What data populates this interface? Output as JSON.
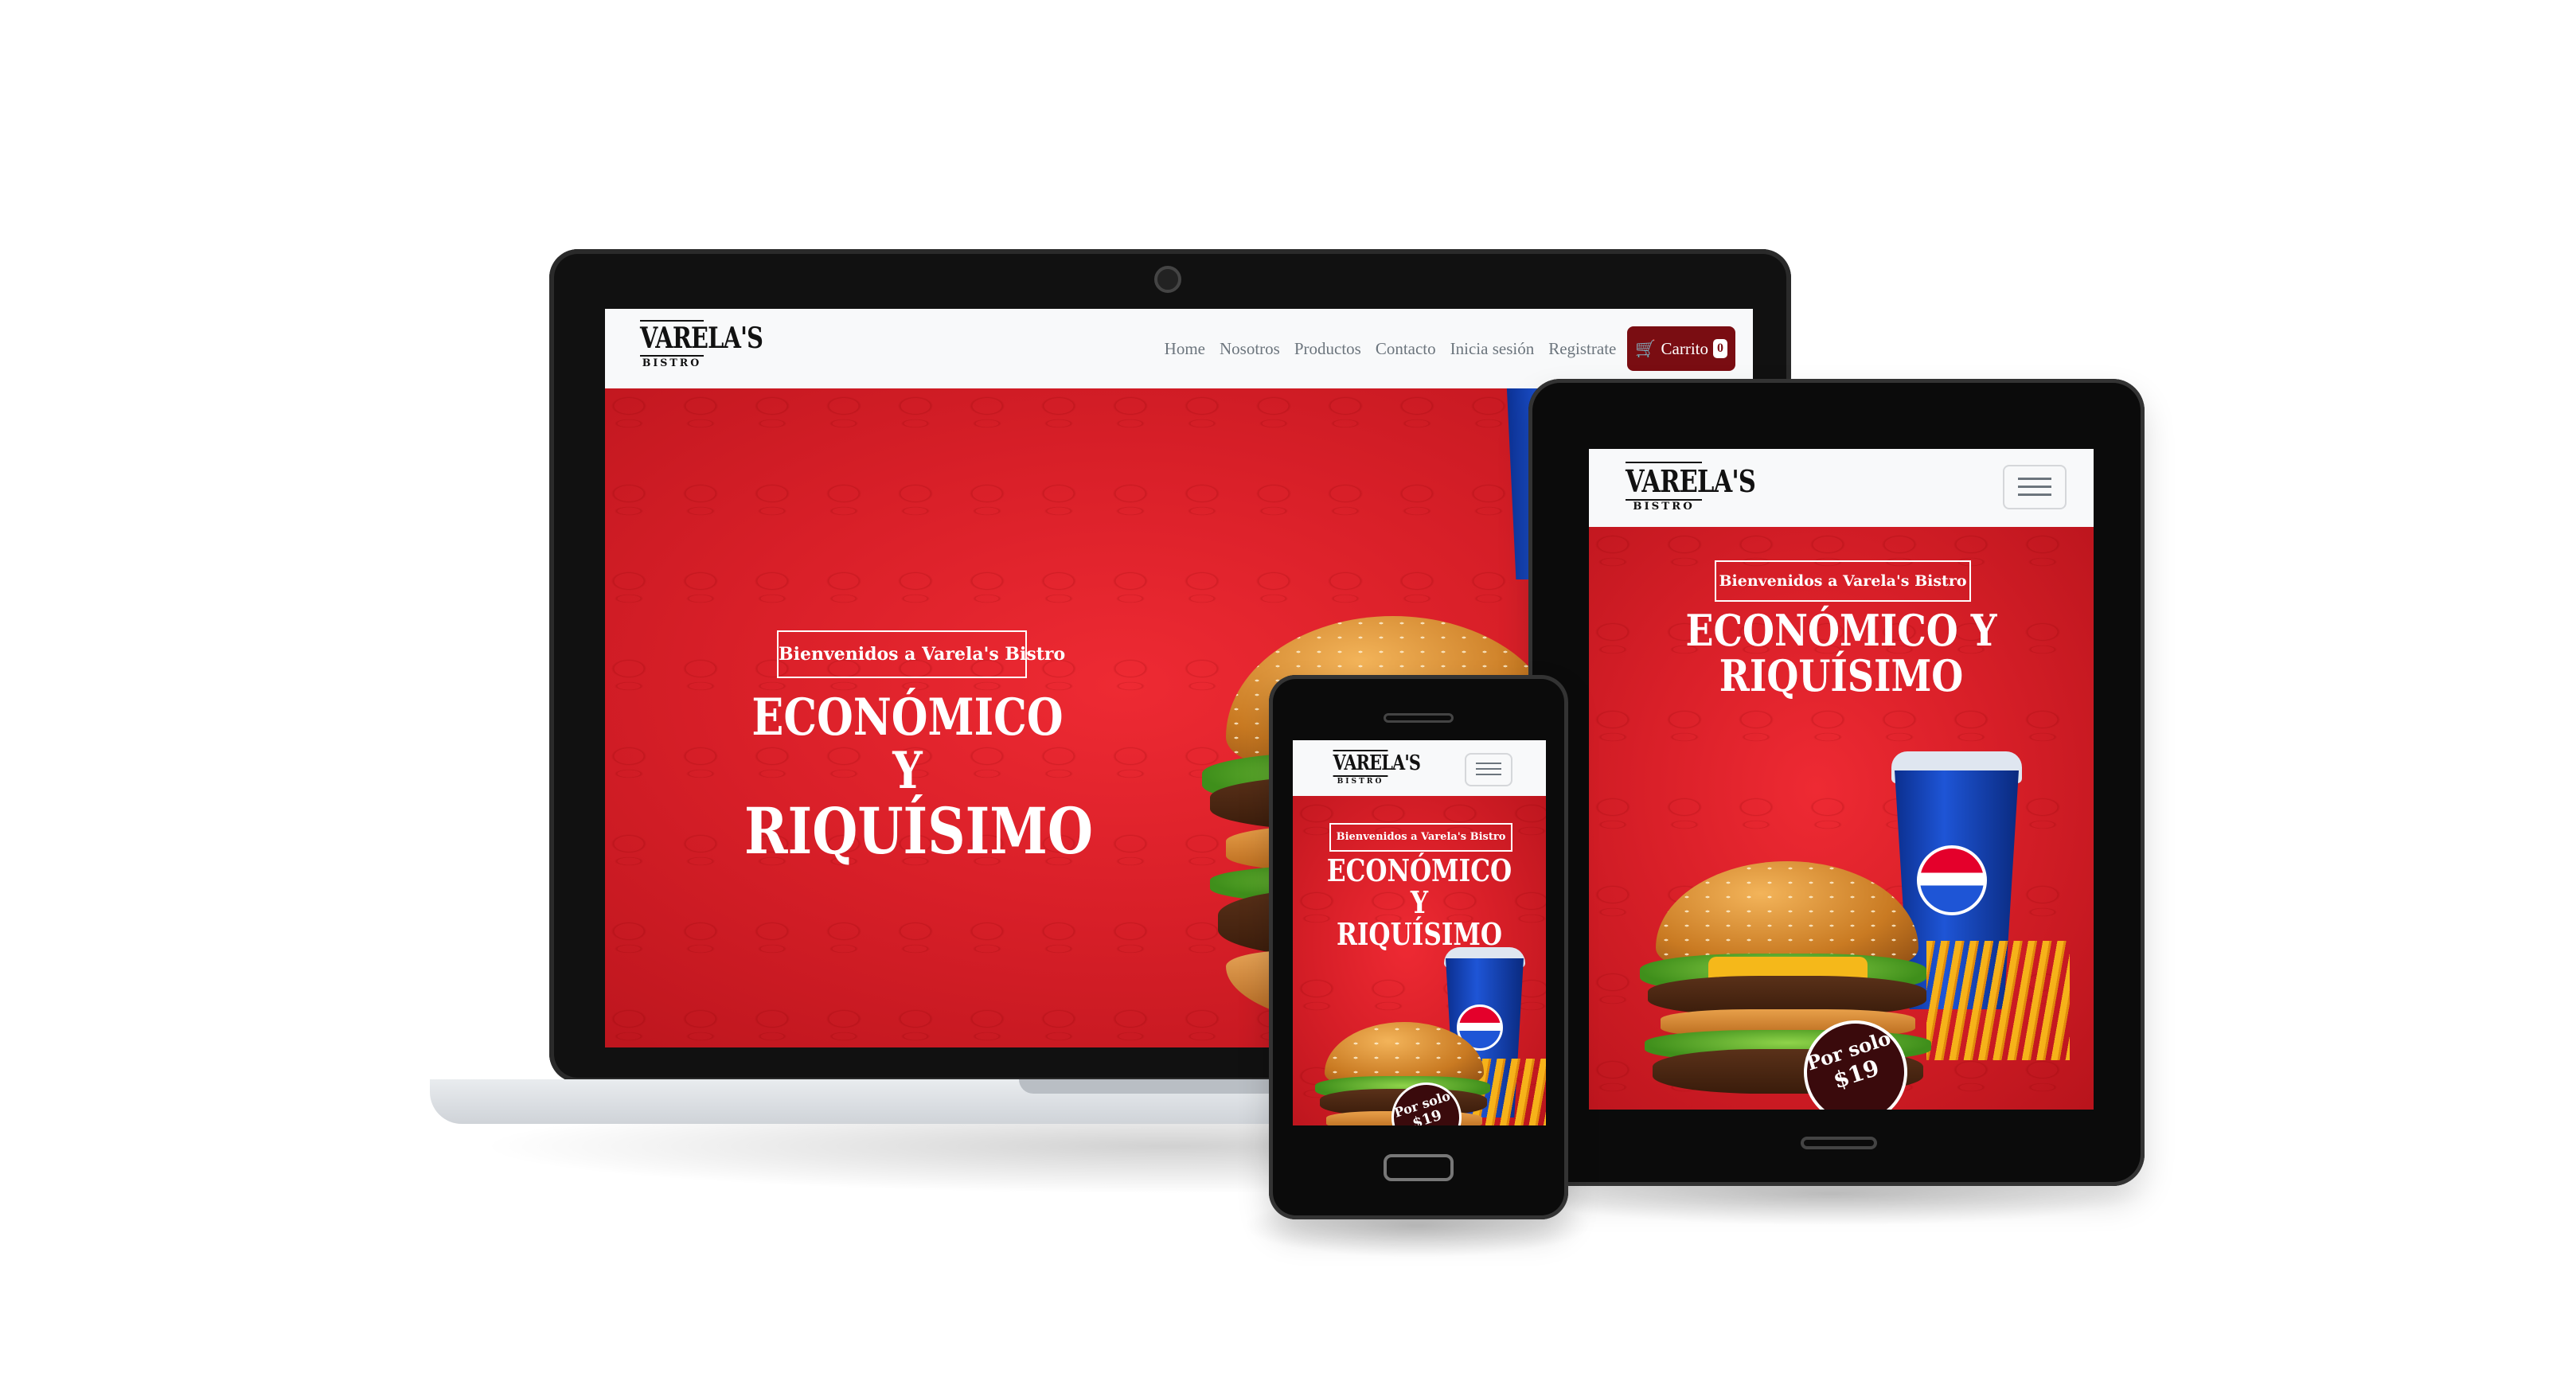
{
  "brand": {
    "logo_word": "VARELA'S",
    "logo_sub": "BISTRO"
  },
  "nav": {
    "links": [
      "Home",
      "Nosotros",
      "Productos",
      "Contacto",
      "Inicia sesión",
      "Registrate"
    ],
    "cart_label": "Carrito",
    "cart_count": "0"
  },
  "hero": {
    "welcome": "Bienvenidos a Varela's Bistro",
    "headline_line1": "ECONÓMICO Y",
    "headline_line2": "RIQUÍSIMO",
    "price_line1": "Por solo",
    "price_line2": "$19"
  },
  "icons": {
    "cart": "cart-icon",
    "menu": "hamburger-menu-icon"
  },
  "colors": {
    "hero_red": "#d81f28",
    "cart_button": "#7a0d12",
    "nav_bg": "#f8f9fa"
  }
}
